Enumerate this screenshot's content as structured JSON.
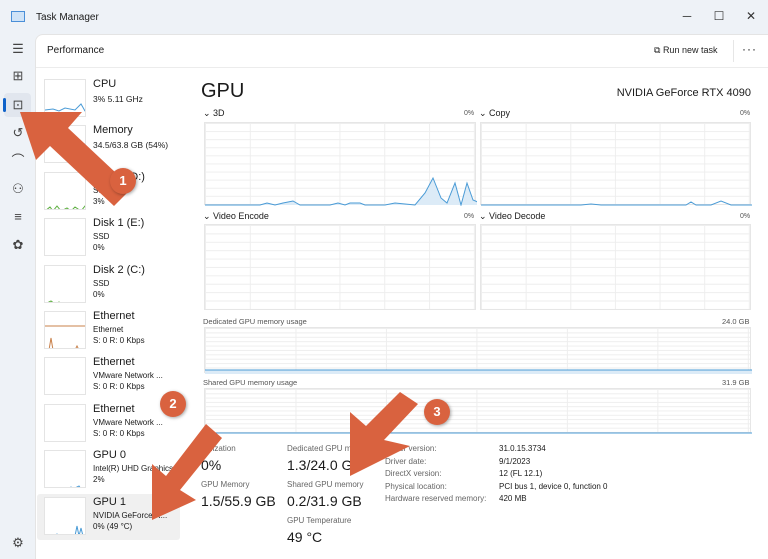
{
  "window": {
    "title": "Task Manager",
    "minimize": "─",
    "maximize": "☐",
    "close": "✕"
  },
  "rail": {
    "icons": [
      "hamburger-icon",
      "processes-icon",
      "performance-icon",
      "app-history-icon",
      "startup-icon",
      "users-icon",
      "details-icon",
      "services-icon",
      "settings-icon"
    ],
    "selected": "performance"
  },
  "header": {
    "title": "Performance",
    "run_new_task": "Run new task",
    "more": "···"
  },
  "sidebar": {
    "items": [
      {
        "name": "CPU",
        "sub1": "3%  5.11 GHz",
        "sub2": "",
        "color": "#4a9bd6"
      },
      {
        "name": "Memory",
        "sub1": "34.5/63.8 GB (54%)",
        "sub2": "",
        "color": "#9b4fc4"
      },
      {
        "name": "Disk 0 (D:)",
        "sub1": "SSD",
        "sub2": "3%",
        "color": "#5aae3c"
      },
      {
        "name": "Disk 1 (E:)",
        "sub1": "SSD",
        "sub2": "0%",
        "color": "#5aae3c"
      },
      {
        "name": "Disk 2 (C:)",
        "sub1": "SSD",
        "sub2": "0%",
        "color": "#5aae3c"
      },
      {
        "name": "Ethernet",
        "sub1": "Ethernet",
        "sub2": "S: 0 R: 0 Kbps",
        "color": "#c8804a"
      },
      {
        "name": "Ethernet",
        "sub1": "VMware Network ...",
        "sub2": "S: 0 R: 0 Kbps",
        "color": "#c8804a"
      },
      {
        "name": "Ethernet",
        "sub1": "VMware Network ...",
        "sub2": "S: 0 R: 0 Kbps",
        "color": "#c8804a"
      },
      {
        "name": "GPU 0",
        "sub1": "Intel(R) UHD Graphics",
        "sub2": "2%",
        "color": "#4a9bd6"
      },
      {
        "name": "GPU 1",
        "sub1": "NVIDIA GeForce R...",
        "sub2": "0%  (49 °C)",
        "color": "#4a9bd6"
      }
    ],
    "selected_index": 9
  },
  "main": {
    "title": "GPU",
    "model": "NVIDIA GeForce RTX 4090",
    "engines": [
      {
        "label": "3D",
        "pct": "0%"
      },
      {
        "label": "Copy",
        "pct": "0%"
      },
      {
        "label": "Video Encode",
        "pct": "0%"
      },
      {
        "label": "Video Decode",
        "pct": "0%"
      }
    ],
    "dedicated": {
      "label": "Dedicated GPU memory usage",
      "max": "24.0 GB"
    },
    "shared": {
      "label": "Shared GPU memory usage",
      "max": "31.9 GB"
    },
    "stats": {
      "utilization_label": "Utilization",
      "utilization": "0%",
      "gpu_mem_label": "GPU Memory",
      "gpu_mem": "1.5/55.9 GB",
      "ded_label": "Dedicated GPU memory",
      "ded": "1.3/24.0 GB",
      "shared_label": "Shared GPU memory",
      "shared": "0.2/31.9 GB",
      "temp_label": "GPU Temperature",
      "temp": "49 °C"
    },
    "props": [
      {
        "k": "Driver version:",
        "v": "31.0.15.3734"
      },
      {
        "k": "Driver date:",
        "v": "9/1/2023"
      },
      {
        "k": "DirectX version:",
        "v": "12 (FL 12.1)"
      },
      {
        "k": "Physical location:",
        "v": "PCI bus 1, device 0, function 0"
      },
      {
        "k": "Hardware reserved memory:",
        "v": "420 MB"
      }
    ]
  },
  "annotations": {
    "badges": [
      "1",
      "2",
      "3"
    ],
    "color": "#d9623f"
  }
}
